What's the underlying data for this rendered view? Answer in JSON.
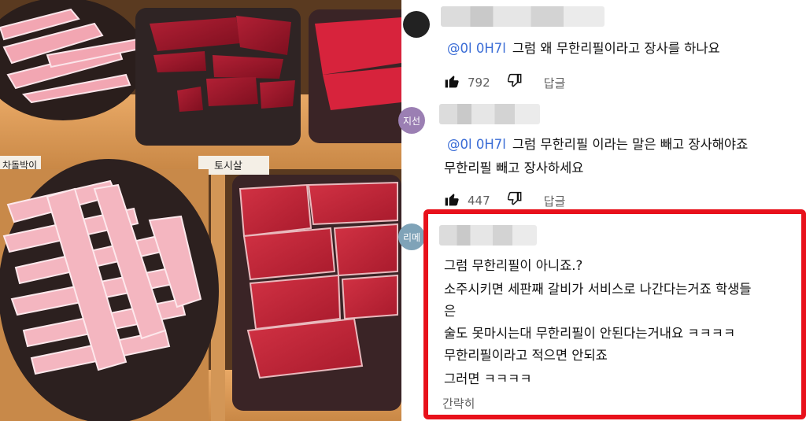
{
  "photo": {
    "labels": [
      "차돌박이",
      "토시살"
    ],
    "alt_subject": "raw meat trays at buffet"
  },
  "comments": [
    {
      "mention": "@0l 0H7l",
      "text_lines": [
        "그럼 왜 무한리필이라고 장사를 하나요"
      ],
      "likes": "792",
      "reply_label": "답글",
      "avatar_text": ""
    },
    {
      "mention": "@0l 0H7l",
      "text_lines": [
        "그럼 무한리필 이라는 말은 빼고 장사해야죠",
        "무한리필 빼고 장사하세요"
      ],
      "likes": "447",
      "reply_label": "답글",
      "avatar_text": "지선"
    },
    {
      "avatar_text": "리메",
      "text_lines": [
        "그럼 무한리필이 아니죠.?",
        "소주시키면 세판째 갈비가 서비스로 나간다는거죠 학생들",
        "은",
        "술도 못마시는대 무한리필이 안된다는거내요 ㅋㅋㅋㅋ",
        "무한리필이라고 적으면 안되죠",
        "그러면 ㅋㅋㅋㅋ"
      ],
      "collapse_label": "간략히",
      "highlight_color": "#e8111b"
    }
  ],
  "colors": {
    "mention": "#3b6dd6",
    "meta": "#606060",
    "text": "#111111",
    "highlight": "#e8111b"
  },
  "icons": [
    "like-icon",
    "dislike-icon"
  ]
}
